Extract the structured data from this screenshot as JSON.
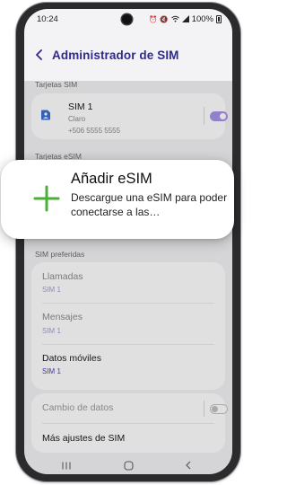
{
  "status_bar": {
    "time": "10:24",
    "battery": "100%",
    "icons": [
      "alarm-icon",
      "mute-icon",
      "wifi-icon",
      "signal-icon",
      "battery-icon"
    ]
  },
  "header": {
    "title": "Administrador de SIM",
    "back_icon": "chevron-left-icon"
  },
  "sections": {
    "sim_cards_label": "Tarjetas SIM",
    "esim_label": "Tarjetas eSIM",
    "preferred_label": "SIM preferidas"
  },
  "sim1": {
    "name": "SIM 1",
    "carrier": "Claro",
    "number": "+506 5555 5555",
    "enabled": true
  },
  "popup": {
    "title": "Añadir eSIM",
    "description": "Descargue una eSIM para poder conectarse a las…",
    "icon": "plus-icon"
  },
  "preferred": [
    {
      "title": "Llamadas",
      "value": "SIM 1"
    },
    {
      "title": "Mensajes",
      "value": "SIM 1"
    },
    {
      "title": "Datos móviles",
      "value": "SIM 1"
    }
  ],
  "extra": {
    "data_switch_label": "Cambio de datos",
    "data_switch_enabled": false,
    "more_settings_label": "Más ajustes de SIM"
  },
  "colors": {
    "accent": "#2f2a8f",
    "toggle_on": "#a892e6",
    "plus_green": "#4caf35",
    "sim_icon_blue": "#3b6fd4"
  }
}
